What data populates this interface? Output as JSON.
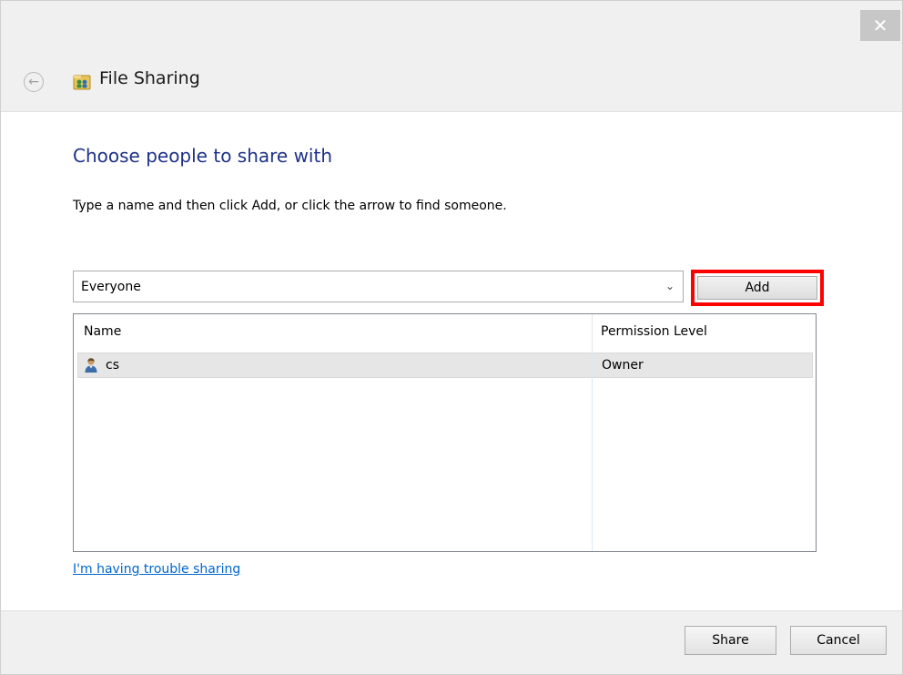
{
  "window": {
    "title": "File Sharing",
    "close_glyph": "✕",
    "back_glyph": "←"
  },
  "content": {
    "heading": "Choose people to share with",
    "instruction": "Type a name and then click Add, or click the arrow to find someone.",
    "name_combo": {
      "value": "Everyone",
      "arrow_glyph": "⌄"
    },
    "add_label": "Add",
    "highlight_color": "#ff0000"
  },
  "list": {
    "columns": [
      "Name",
      "Permission Level"
    ],
    "rows": [
      {
        "name": "cs",
        "permission": "Owner",
        "icon": "user-icon"
      }
    ]
  },
  "help_link": "I'm having trouble sharing",
  "footer": {
    "share_label": "Share",
    "cancel_label": "Cancel"
  },
  "colors": {
    "heading": "#1e3287",
    "link": "#0066cc",
    "selected_row": "#e6e6e6"
  }
}
